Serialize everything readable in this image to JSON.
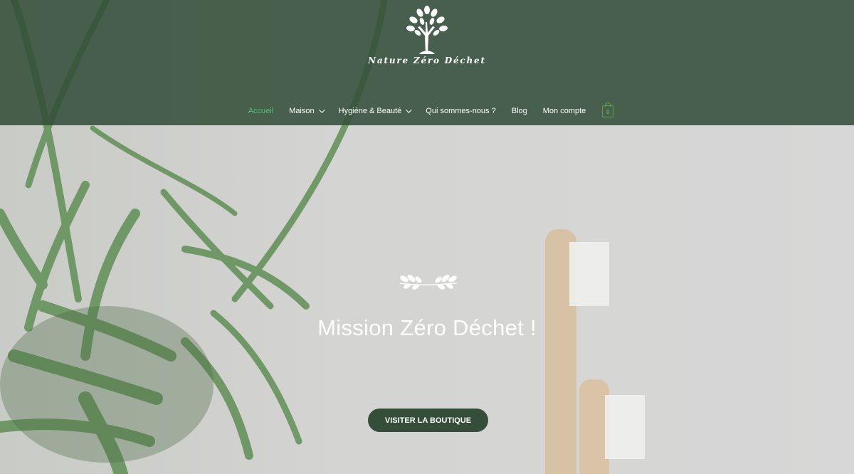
{
  "brand": {
    "name": "Nature Zéro Déchet"
  },
  "nav": {
    "items": [
      {
        "label": "Accueil",
        "active": true,
        "dropdown": false
      },
      {
        "label": "Maison",
        "active": false,
        "dropdown": true
      },
      {
        "label": "Hygiène & Beauté",
        "active": false,
        "dropdown": true
      },
      {
        "label": "Qui sommes-nous ?",
        "active": false,
        "dropdown": false
      },
      {
        "label": "Blog",
        "active": false,
        "dropdown": false
      },
      {
        "label": "Mon compte",
        "active": false,
        "dropdown": false
      }
    ],
    "cart_count": "0"
  },
  "hero": {
    "title": "Mission Zéro Déchet !",
    "cta_label": "VISITER LA BOUTIQUE"
  },
  "colors": {
    "header_bg": "#344e3a",
    "accent_active": "#4fc27a",
    "cta_bg": "#344e3a",
    "cart_outline": "#5fa34b"
  },
  "icons": {
    "logo": "tree-icon",
    "divider": "laurel-icon",
    "cart": "shopping-bag-icon"
  }
}
